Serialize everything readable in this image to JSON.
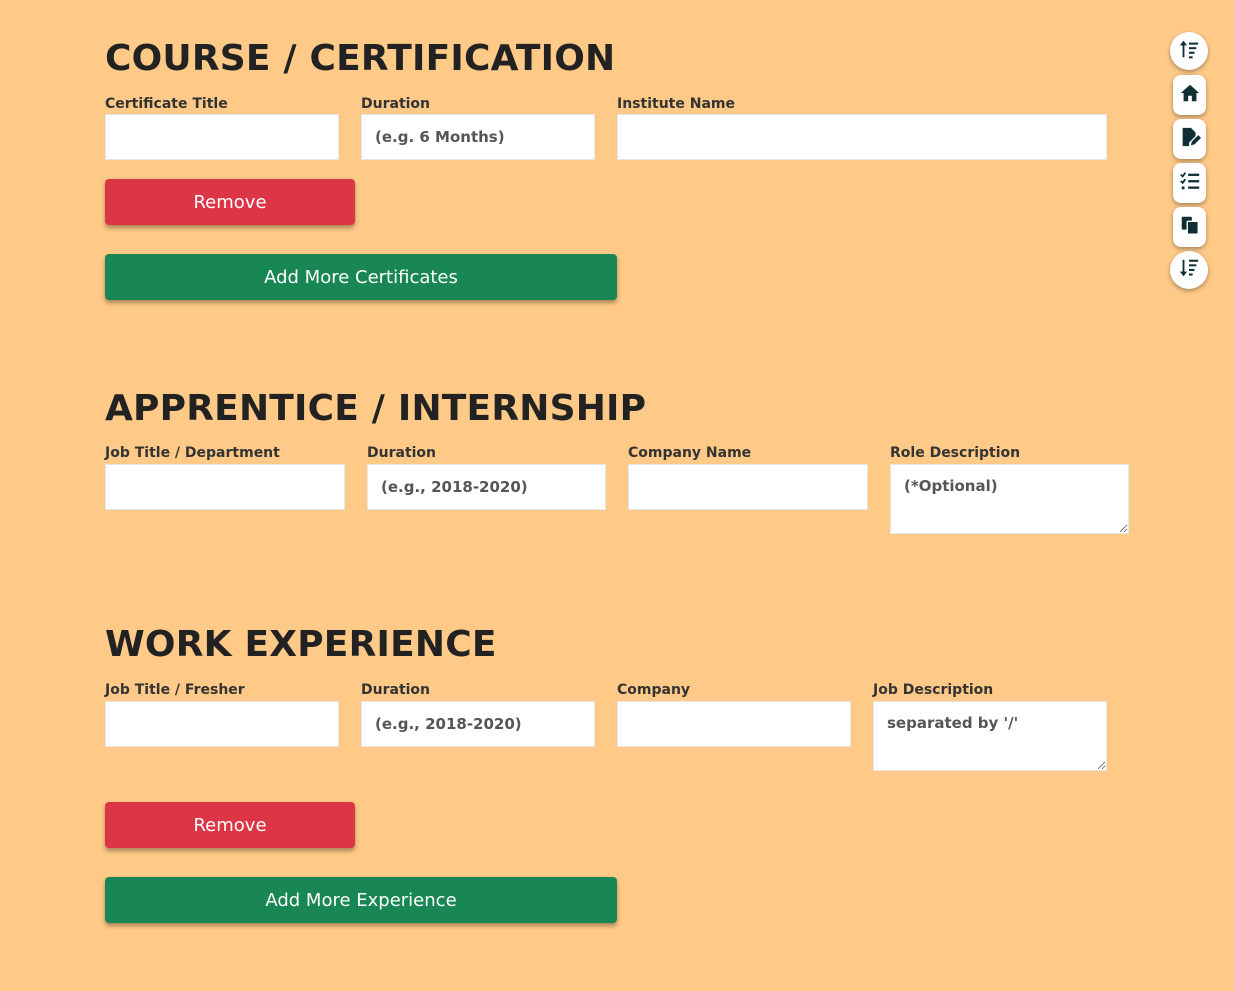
{
  "sections": {
    "course": {
      "title": "COURSE / CERTIFICATION",
      "labels": {
        "title": "Certificate Title",
        "duration": "Duration",
        "institute": "Institute Name"
      },
      "placeholders": {
        "title": "",
        "duration": "(e.g. 6 Months)",
        "institute": ""
      },
      "remove_label": "Remove",
      "add_label": "Add More Certificates"
    },
    "internship": {
      "title": "APPRENTICE / INTERNSHIP",
      "labels": {
        "title": "Job Title / Department",
        "duration": "Duration",
        "company": "Company Name",
        "role": "Role Description"
      },
      "placeholders": {
        "title": "",
        "duration": "(e.g., 2018-2020)",
        "company": "",
        "role": "(*Optional)"
      }
    },
    "work": {
      "title": "WORK EXPERIENCE",
      "labels": {
        "title": "Job Title / Fresher",
        "duration": "Duration",
        "company": "Company",
        "description": "Job Description"
      },
      "placeholders": {
        "title": "",
        "duration": "(e.g., 2018-2020)",
        "company": "",
        "description": "separated by '/'"
      },
      "remove_label": "Remove",
      "add_label": "Add More Experience"
    }
  },
  "side_nav": [
    {
      "icon": "sort-up-icon"
    },
    {
      "icon": "home-icon"
    },
    {
      "icon": "file-edit-icon"
    },
    {
      "icon": "checklist-icon"
    },
    {
      "icon": "copy-icon"
    },
    {
      "icon": "sort-down-icon"
    }
  ],
  "colors": {
    "background": "#ffca88",
    "remove": "#dc3545",
    "add": "#198754",
    "icon": "#0f2f35"
  }
}
